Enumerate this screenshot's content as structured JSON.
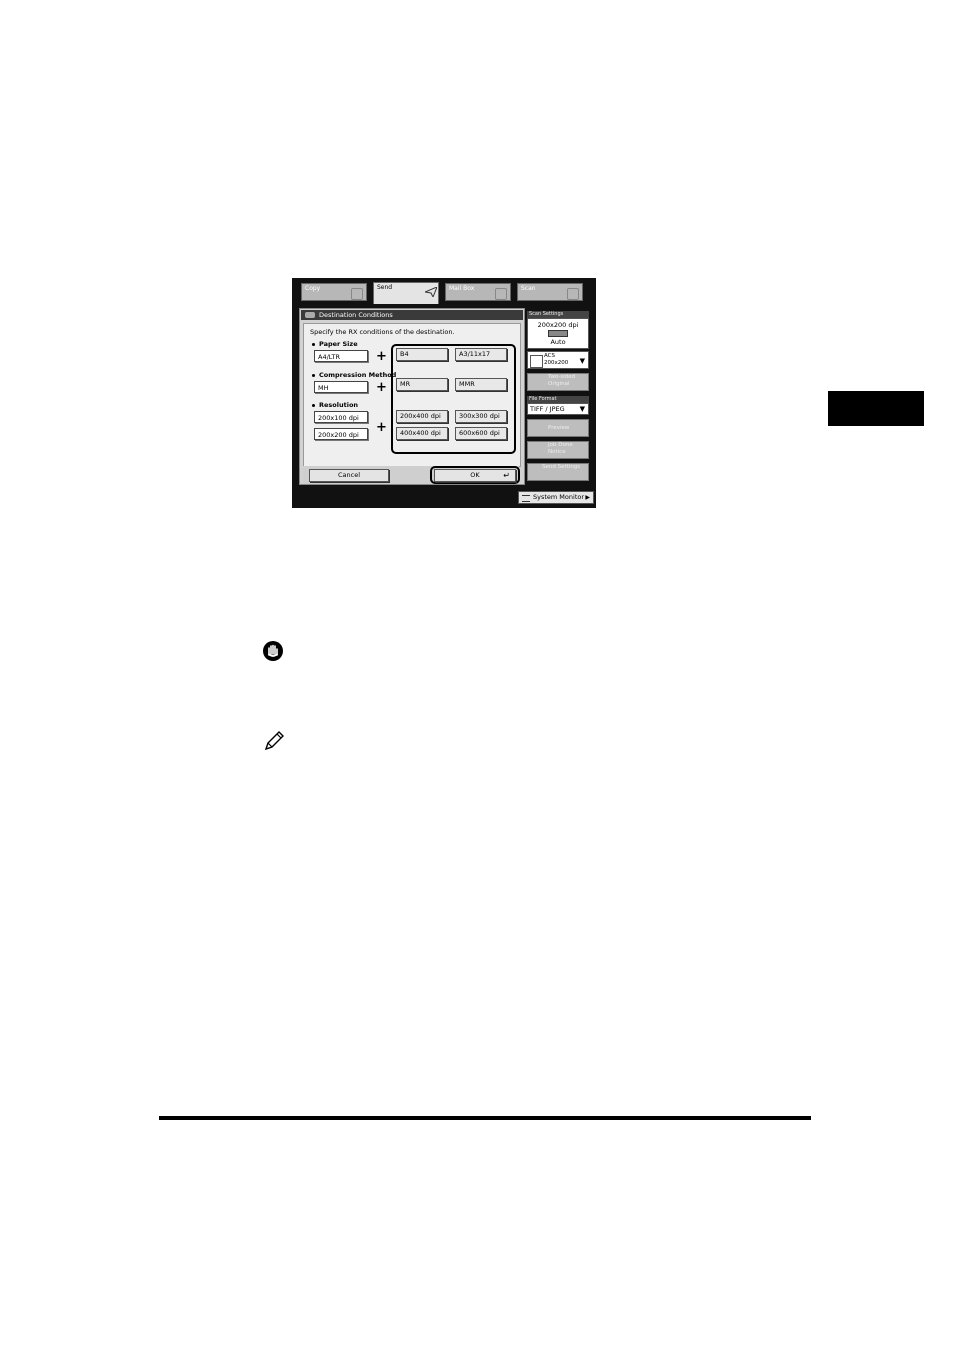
{
  "tabs": [
    {
      "label": "Copy"
    },
    {
      "label": "Send"
    },
    {
      "label": "Mail Box"
    },
    {
      "label": "Scan"
    }
  ],
  "dialog": {
    "title": "Destination Conditions",
    "instruction": "Specify the RX conditions of the destination.",
    "paper_size": {
      "label": "Paper Size",
      "value": "A4/LTR"
    },
    "compression": {
      "label": "Compression Method",
      "value": "MH"
    },
    "resolution": {
      "label": "Resolution",
      "values": [
        "200x100 dpi",
        "200x200 dpi"
      ]
    },
    "options": [
      "B4",
      "A3/11x17",
      "MR",
      "MMR",
      "200x400 dpi",
      "300x300 dpi",
      "400x400 dpi",
      "600x600 dpi"
    ],
    "plus": "+",
    "cancel_label": "Cancel",
    "ok_label": "OK"
  },
  "side_panel": {
    "scan_settings_label": "Scan Settings",
    "resolution": "200x200 dpi",
    "density": "Auto",
    "mode_line1": "ACS",
    "mode_line2": "200x200",
    "two_sided": "Two-sided Original",
    "file_format_label": "File Format",
    "file_format": "TIFF / JPEG",
    "preview": "Preview",
    "job_done": "Job Done Notice",
    "send_settings": "Send Settings"
  },
  "system_monitor_label": "System Monitor",
  "icons": {
    "caution": "caution-hand-icon",
    "note": "pencil-note-icon"
  }
}
